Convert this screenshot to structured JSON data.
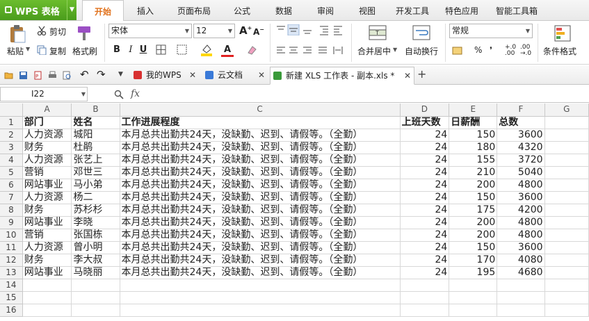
{
  "app": {
    "title": "WPS 表格"
  },
  "menu_tabs": [
    "开始",
    "插入",
    "页面布局",
    "公式",
    "数据",
    "审阅",
    "视图",
    "开发工具",
    "特色应用",
    "智能工具箱"
  ],
  "active_tab_index": 0,
  "ribbon": {
    "paste": "粘贴",
    "cut": "剪切",
    "copy": "复制",
    "format_painter": "格式刷",
    "font_name": "宋体",
    "font_size": "12",
    "merge_center": "合并居中",
    "wrap_text": "自动换行",
    "number_format": "常规",
    "percent": "%",
    "thousands": "❜",
    "conditional_format": "条件格式"
  },
  "doc_tabs": [
    {
      "label": "我的WPS",
      "icon": "wps-logo-icon"
    },
    {
      "label": "云文档",
      "icon": "cloud-box-icon"
    },
    {
      "label": "新建 XLS 工作表 - 副本.xls *",
      "icon": "spreadsheet-file-icon"
    }
  ],
  "formula_bar": {
    "cell_ref": "I22",
    "fx": "fx",
    "formula": ""
  },
  "sheet": {
    "columns": [
      "A",
      "B",
      "C",
      "D",
      "E",
      "F",
      "G"
    ],
    "header_row": [
      "部门",
      "姓名",
      "工作进展程度",
      "上班天数",
      "日薪酬",
      "总数"
    ],
    "rows": [
      [
        "人力资源",
        "城阳",
        "本月总共出勤共24天，没缺勤、迟到、请假等。（全勤）",
        "24",
        "150",
        "3600"
      ],
      [
        "财务",
        "杜鹃",
        "本月总共出勤共24天，没缺勤、迟到、请假等。（全勤）",
        "24",
        "180",
        "4320"
      ],
      [
        "人力资源",
        "张艺上",
        "本月总共出勤共24天，没缺勤、迟到、请假等。（全勤）",
        "24",
        "155",
        "3720"
      ],
      [
        "营销",
        "邓世三",
        "本月总共出勤共24天，没缺勤、迟到、请假等。（全勤）",
        "24",
        "210",
        "5040"
      ],
      [
        "网站事业",
        "马小弟",
        "本月总共出勤共24天，没缺勤、迟到、请假等。（全勤）",
        "24",
        "200",
        "4800"
      ],
      [
        "人力资源",
        "杨二",
        "本月总共出勤共24天，没缺勤、迟到、请假等。（全勤）",
        "24",
        "150",
        "3600"
      ],
      [
        "财务",
        "苏杉杉",
        "本月总共出勤共24天，没缺勤、迟到、请假等。（全勤）",
        "24",
        "175",
        "4200"
      ],
      [
        "网站事业",
        "李晓",
        "本月总共出勤共24天，没缺勤、迟到、请假等。（全勤）",
        "24",
        "200",
        "4800"
      ],
      [
        "营销",
        "张国栋",
        "本月总共出勤共24天，没缺勤、迟到、请假等。（全勤）",
        "24",
        "200",
        "4800"
      ],
      [
        "人力资源",
        "曾小明",
        "本月总共出勤共24天，没缺勤、迟到、请假等。（全勤）",
        "24",
        "150",
        "3600"
      ],
      [
        "财务",
        "李大叔",
        "本月总共出勤共24天，没缺勤、迟到、请假等。（全勤）",
        "24",
        "170",
        "4080"
      ],
      [
        "网站事业",
        "马晓丽",
        "本月总共出勤共24天，没缺勤、迟到、请假等。（全勤）",
        "24",
        "195",
        "4680"
      ]
    ],
    "empty_row_numbers": [
      "14",
      "15",
      "16"
    ],
    "colors": {
      "accent_orange": "#e0701a",
      "app_green": "#4a9c1c",
      "grid": "#d8d8d8",
      "header_bg": "#f2f2f2"
    }
  }
}
